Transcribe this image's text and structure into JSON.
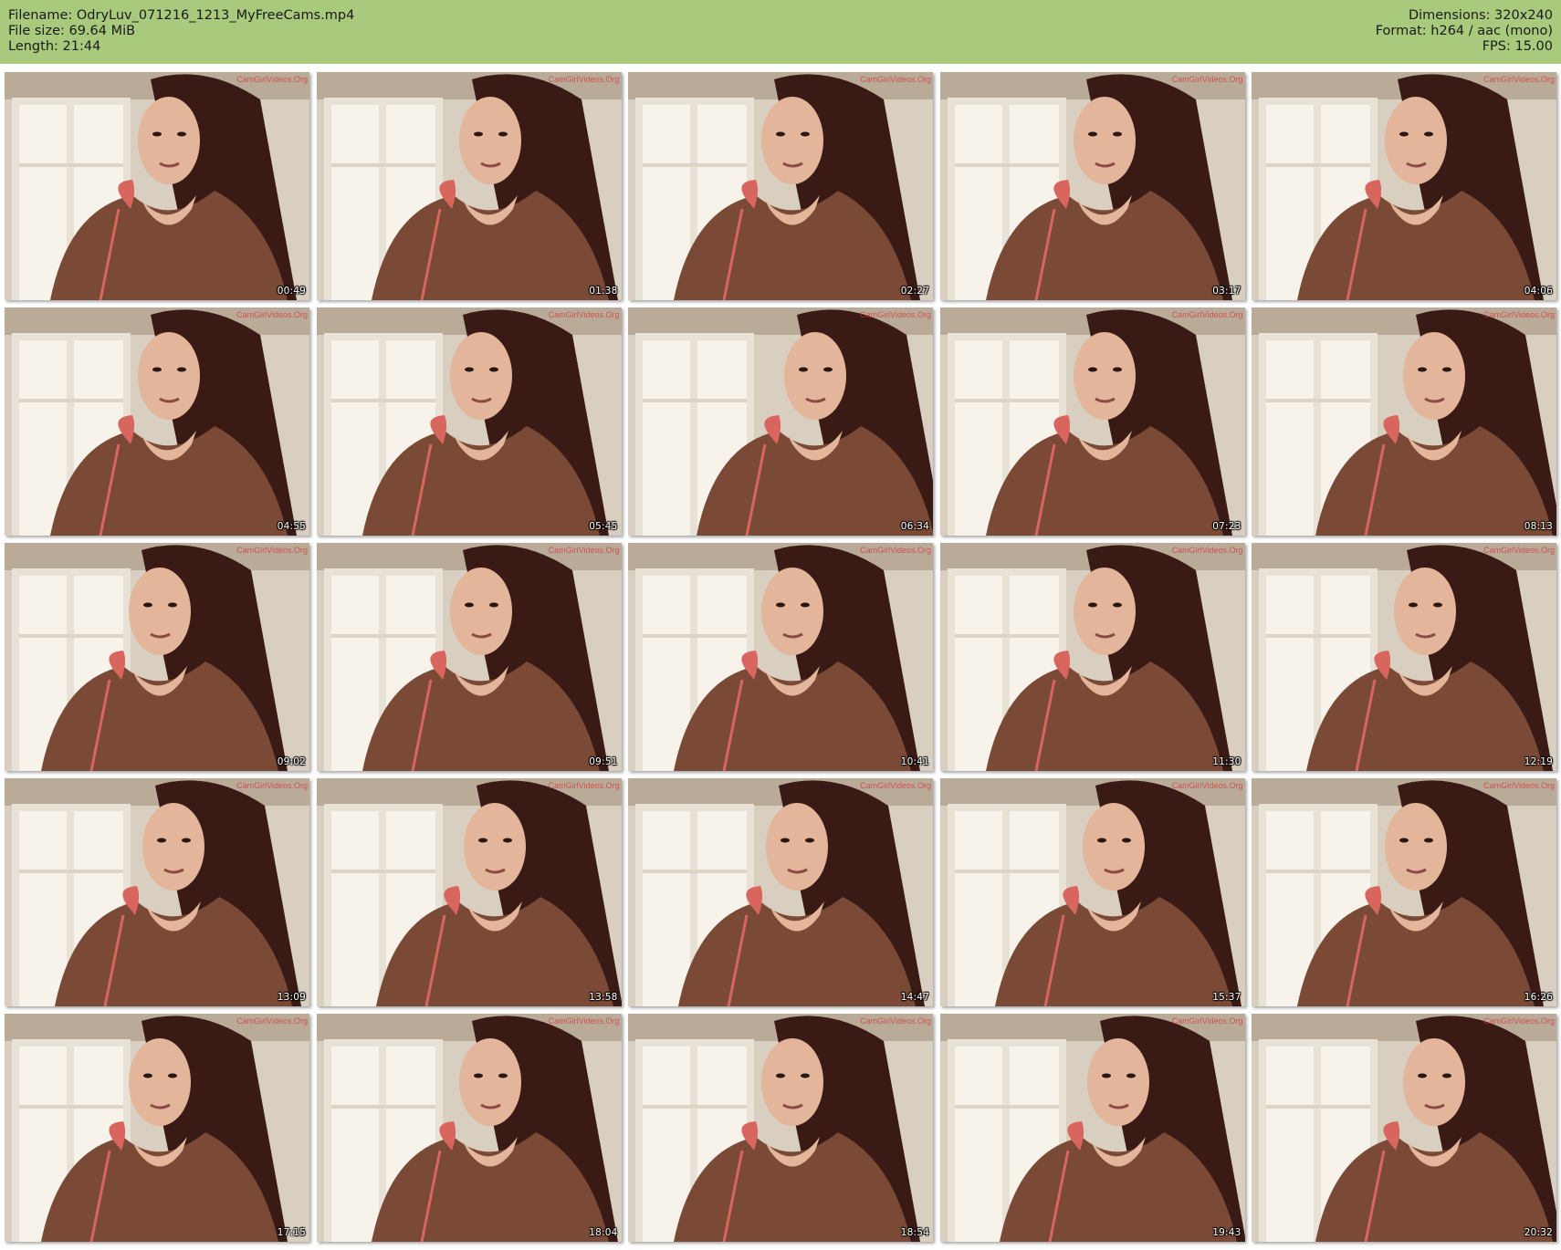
{
  "header": {
    "filename": "Filename: OdryLuv_071216_1213_MyFreeCams.mp4",
    "file_size": "File size: 69.64 MiB",
    "length": "Length: 21:44",
    "dimensions": "Dimensions: 320x240",
    "format": "Format: h264 / aac (mono)",
    "fps": "FPS: 15.00"
  },
  "colors": {
    "header_bg": "#a9c97d",
    "wall": "#d9cfc1",
    "window_glass": "#f7f3ea",
    "window_frame": "#e8e2d6",
    "hoodie": "#7a4a36",
    "hood_trim": "#d9655f",
    "hair": "#3a1a14",
    "skin": "#e3b59a"
  },
  "watermark_text": "CamGirlVideos.Org",
  "thumbnails": [
    {
      "time": "00:49"
    },
    {
      "time": "01:38"
    },
    {
      "time": "02:27"
    },
    {
      "time": "03:17"
    },
    {
      "time": "04:06"
    },
    {
      "time": "04:55"
    },
    {
      "time": "05:45"
    },
    {
      "time": "06:34"
    },
    {
      "time": "07:23"
    },
    {
      "time": "08:13"
    },
    {
      "time": "09:02"
    },
    {
      "time": "09:51"
    },
    {
      "time": "10:41"
    },
    {
      "time": "11:30"
    },
    {
      "time": "12:19"
    },
    {
      "time": "13:09"
    },
    {
      "time": "13:58"
    },
    {
      "time": "14:47"
    },
    {
      "time": "15:37"
    },
    {
      "time": "16:26"
    },
    {
      "time": "17:15"
    },
    {
      "time": "18:04"
    },
    {
      "time": "18:54"
    },
    {
      "time": "19:43"
    },
    {
      "time": "20:32"
    }
  ]
}
